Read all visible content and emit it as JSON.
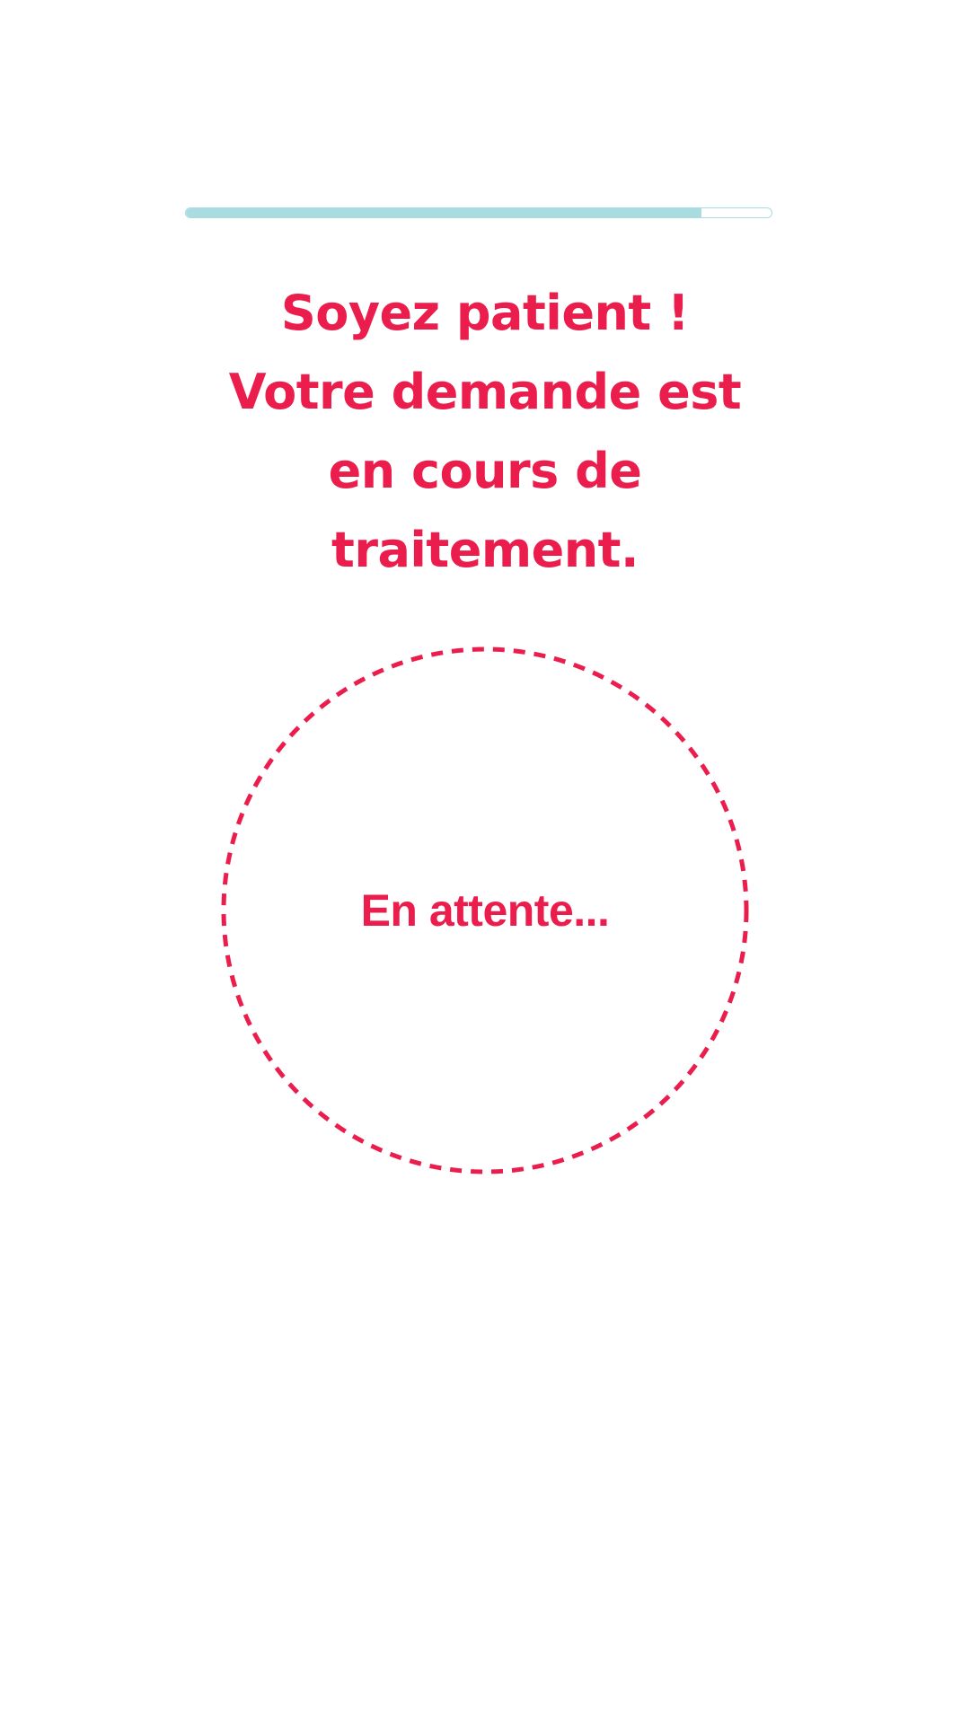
{
  "progress": {
    "percent": 88,
    "color": "#a9dce0"
  },
  "headline": {
    "lines": [
      "Soyez patient !",
      "Votre demande est",
      "en cours de",
      "traitement."
    ]
  },
  "status": {
    "label": "En attente..."
  },
  "colors": {
    "accent": "#ea1d4c",
    "background": "#ffffff"
  }
}
